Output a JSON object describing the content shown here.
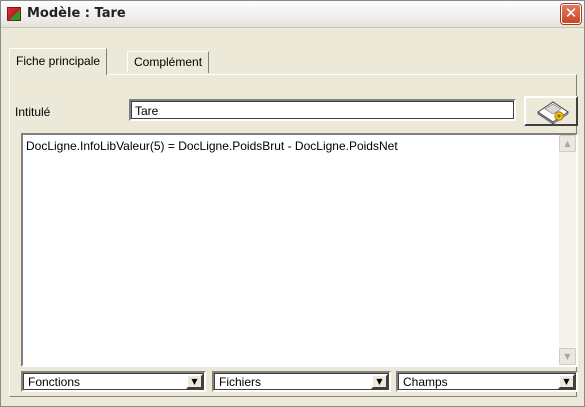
{
  "window": {
    "title": "Modèle : Tare",
    "close_glyph": "✕",
    "app_icon": "ledger-icon"
  },
  "tabs": [
    {
      "label": "Fiche principale",
      "active": true
    },
    {
      "label": "Complément",
      "active": false
    }
  ],
  "form": {
    "intitule_label": "Intitulé",
    "intitule_value": "Tare",
    "calculator_icon": "calculator-icon"
  },
  "editor": {
    "formula": "DocLigne.InfoLibValeur(5) = DocLigne.PoidsBrut - DocLigne.PoidsNet",
    "scroll_up_glyph": "▲",
    "scroll_down_glyph": "▼"
  },
  "dropdowns": {
    "fonctions": "Fonctions",
    "fichiers": "Fichiers",
    "champs": "Champs",
    "arrow_glyph": "▼"
  }
}
